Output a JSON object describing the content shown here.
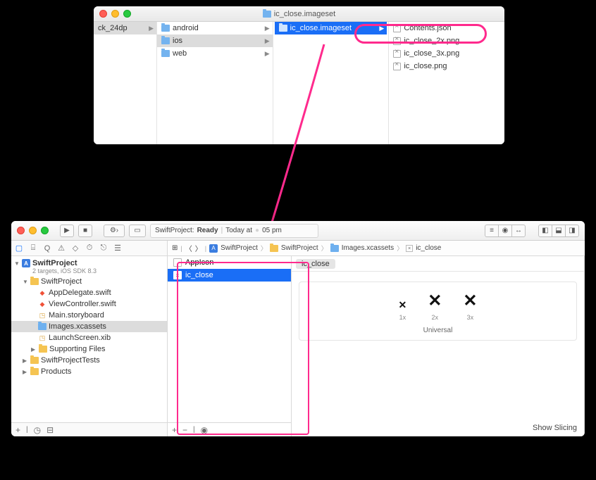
{
  "finder": {
    "title": "ic_close.imageset",
    "col0": {
      "item": "ck_24dp"
    },
    "col1": {
      "items": [
        "android",
        "ios",
        "web"
      ],
      "selectedIndex": 1
    },
    "col2": {
      "items": [
        "ic_close.imageset"
      ],
      "selectedIndex": 0
    },
    "col3": {
      "items": [
        "Contents.json",
        "ic_close_2x.png",
        "ic_close_3x.png",
        "ic_close.png"
      ]
    }
  },
  "xcode": {
    "toolbar": {
      "status_project": "SwiftProject:",
      "status_state": "Ready",
      "status_time_prefix": "Today at",
      "status_time": "05 pm"
    },
    "breadcrumb": [
      "SwiftProject",
      "SwiftProject",
      "Images.xcassets",
      "ic_close"
    ],
    "nav": {
      "project": "SwiftProject",
      "subtitle": "2 targets, iOS SDK 8.3",
      "group": "SwiftProject",
      "files": [
        "AppDelegate.swift",
        "ViewController.swift",
        "Main.storyboard",
        "Images.xcassets",
        "LaunchScreen.xib"
      ],
      "supporting": "Supporting Files",
      "tests": "SwiftProjectTests",
      "products": "Products"
    },
    "assets": {
      "items": [
        "AppIcon",
        "ic_close"
      ],
      "selectedIndex": 1
    },
    "canvas": {
      "name": "ic_close",
      "slot_labels": [
        "1x",
        "2x",
        "3x"
      ],
      "universal": "Universal",
      "show_slicing": "Show Slicing"
    }
  }
}
